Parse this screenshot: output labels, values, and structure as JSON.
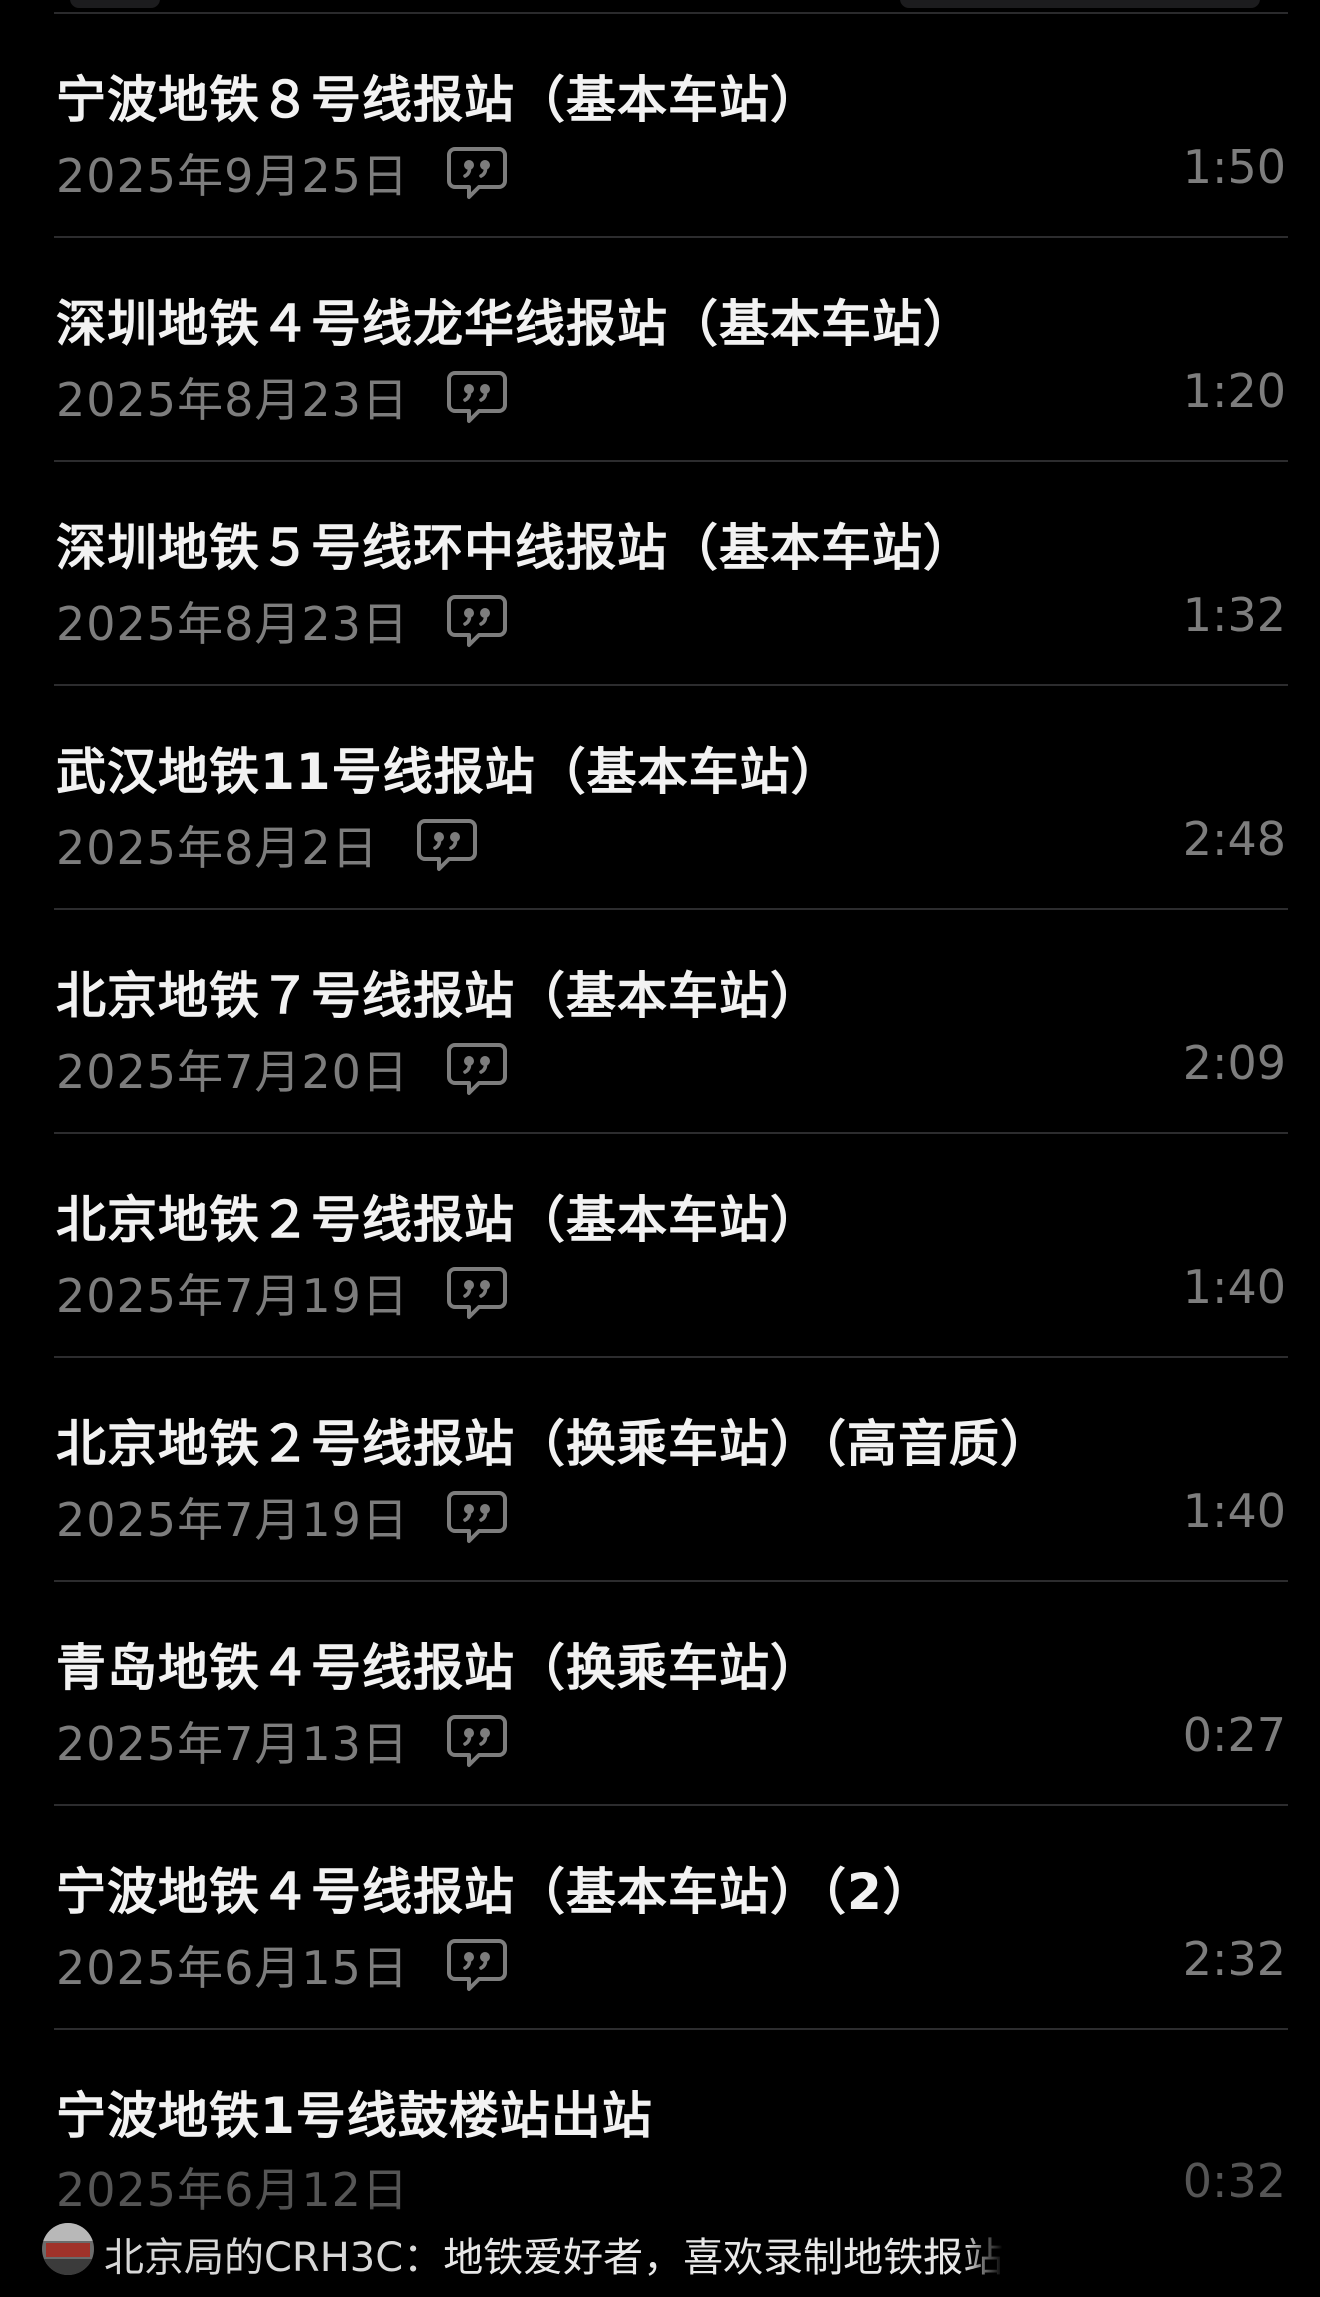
{
  "tracks": [
    {
      "title": "宁波地铁８号线报站（基本车站）",
      "date": "2025年9月25日",
      "duration": "1:50",
      "has_lyrics": true
    },
    {
      "title": "深圳地铁４号线龙华线报站（基本车站）",
      "date": "2025年8月23日",
      "duration": "1:20",
      "has_lyrics": true
    },
    {
      "title": "深圳地铁５号线环中线报站（基本车站）",
      "date": "2025年8月23日",
      "duration": "1:32",
      "has_lyrics": true
    },
    {
      "title": "武汉地铁11号线报站（基本车站）",
      "date": "2025年8月2日",
      "duration": "2:48",
      "has_lyrics": true
    },
    {
      "title": "北京地铁７号线报站（基本车站）",
      "date": "2025年7月20日",
      "duration": "2:09",
      "has_lyrics": true
    },
    {
      "title": "北京地铁２号线报站（基本车站）",
      "date": "2025年7月19日",
      "duration": "1:40",
      "has_lyrics": true
    },
    {
      "title": "北京地铁２号线报站（换乘车站）（高音质）",
      "date": "2025年7月19日",
      "duration": "1:40",
      "has_lyrics": true
    },
    {
      "title": "青岛地铁４号线报站（换乘车站）",
      "date": "2025年7月13日",
      "duration": "0:27",
      "has_lyrics": true
    },
    {
      "title": "宁波地铁４号线报站（基本车站）（2）",
      "date": "2025年6月15日",
      "duration": "2:32",
      "has_lyrics": true
    },
    {
      "title": "宁波地铁1号线鼓楼站出站",
      "date": "2025年6月12日",
      "duration": "0:32",
      "has_lyrics": false
    }
  ],
  "footer": {
    "author": "北京局的CRH3C：",
    "text": "地铁爱好者，喜欢录制地铁报",
    "text_faded": "站"
  },
  "icons": {
    "lyrics": "lyrics-bubble-icon",
    "avatar": "avatar-train-image"
  },
  "colors": {
    "background": "#000000",
    "title": "#f2f2f2",
    "secondary": "#7d7d7d",
    "divider": "#2c2c2e"
  }
}
